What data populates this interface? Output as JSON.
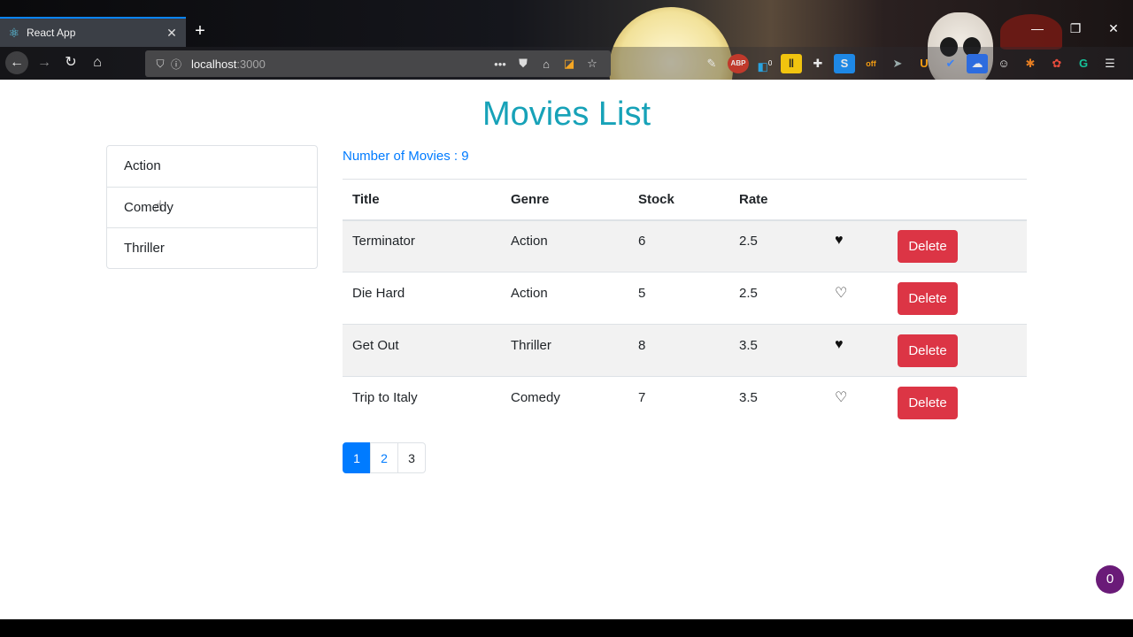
{
  "browser": {
    "tab_title": "React App",
    "tab_favicon": "react-atom-icon",
    "url_host": "localhost",
    "url_port": ":3000",
    "new_tab_glyph": "+",
    "minimize_glyph": "—",
    "restore_glyph": "❐",
    "close_glyph": "✕",
    "extension_badges": {
      "notifications": "0",
      "off": "off"
    }
  },
  "page": {
    "title": "Movies List",
    "count_text": "Number of Movies : 9"
  },
  "genres": [
    "Action",
    "Comedy",
    "Thriller"
  ],
  "table": {
    "headers": [
      "Title",
      "Genre",
      "Stock",
      "Rate"
    ],
    "rows": [
      {
        "title": "Terminator",
        "genre": "Action",
        "stock": "6",
        "rate": "2.5",
        "liked": true
      },
      {
        "title": "Die Hard",
        "genre": "Action",
        "stock": "5",
        "rate": "2.5",
        "liked": false
      },
      {
        "title": "Get Out",
        "genre": "Thriller",
        "stock": "8",
        "rate": "3.5",
        "liked": true
      },
      {
        "title": "Trip to Italy",
        "genre": "Comedy",
        "stock": "7",
        "rate": "3.5",
        "liked": false
      }
    ],
    "delete_label": "Delete"
  },
  "pagination": {
    "pages": [
      "1",
      "2",
      "3"
    ],
    "active": "1"
  },
  "fab": {
    "label": "0"
  },
  "colors": {
    "title": "#17a2b8",
    "link": "#007bff",
    "danger": "#dc3545",
    "fab": "#6a1b78"
  }
}
